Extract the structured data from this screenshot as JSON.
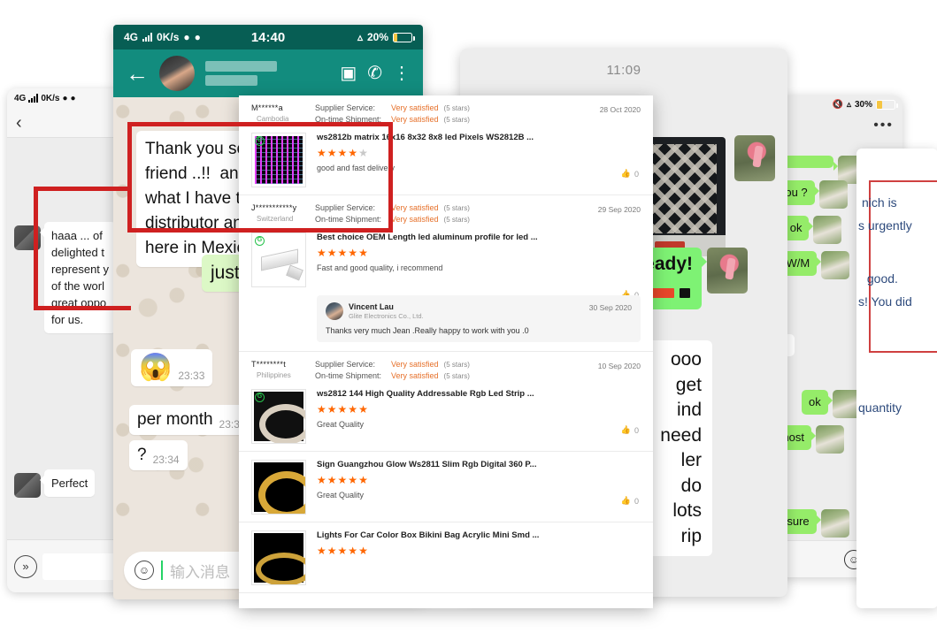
{
  "left_phone": {
    "status": {
      "network": "4G",
      "speed": "0K/s"
    },
    "back_icon": "‹",
    "messages": [
      {
        "text": "haaa ... of\ndelighted t\nrepresent y\nof the worl\ngreat oppo\nfor us."
      },
      {
        "text": "Perfect"
      }
    ],
    "voice_icon": "»"
  },
  "whatsapp": {
    "status": {
      "network": "4G",
      "speed": "0K/s",
      "time": "14:40",
      "battery": "20%"
    },
    "nav": {
      "back_icon": "←",
      "video_icon": "▶",
      "call_icon": "✆",
      "menu_icon": "⋮"
    },
    "messages": [
      {
        "type": "in",
        "text": "Thank you so m\nfriend ..!!  an ac\nwhat I have to c\ndistributor and\nhere in Mexico"
      },
      {
        "type": "out",
        "text": "just se"
      },
      {
        "type": "emoji",
        "text": "😱",
        "time": "23:33"
      },
      {
        "type": "in",
        "text": "per month",
        "time": "23:3"
      },
      {
        "type": "in",
        "text": "?",
        "time": "23:34"
      }
    ],
    "input": {
      "placeholder": "输入消息",
      "emoji_icon": "☺"
    }
  },
  "wechat_mid": {
    "timestamp": "11:09",
    "messages": [
      {
        "type": "out",
        "text": "ready!"
      },
      {
        "type": "in",
        "text": "ooo\nget\nind\nneed\nler\ndo\nlots\nrip"
      }
    ]
  },
  "wechat_right": {
    "status": {
      "battery": "30%"
    },
    "menu_icon": "•••",
    "messages": [
      {
        "text": "e you ?"
      },
      {
        "text": "v all ok"
      },
      {
        "text": "18W/M"
      },
      {
        "text": "ok"
      },
      {
        "text": "ok"
      },
      {
        "text": "utmost"
      },
      {
        "text": "leasure"
      }
    ],
    "footer": {
      "emoji_icon": "☺",
      "plus_icon": "+"
    }
  },
  "right_card": {
    "lines": [
      "nich is",
      "s urgently",
      " good.",
      "s! You did",
      "quantity"
    ]
  },
  "reviews": {
    "labels": {
      "supplier_service": "Supplier Service:",
      "on_time_shipment": "On-time Shipment:",
      "stars_note": "(5 stars)"
    },
    "items": [
      {
        "buyer": "M******a",
        "country": "Cambodia",
        "date": "28 Oct 2020",
        "supplier_service": "Very satisfied",
        "on_time_shipment": "Very satisfied",
        "product": "ws2812b matrix 16x16 8x32 8x8 led Pixels WS2812B ...",
        "stars": 4,
        "comment": "good and fast delivery",
        "likes": "0",
        "thumb": "matrix-led-thumbnail",
        "reply": null
      },
      {
        "buyer": "J***********y",
        "country": "Switzerland",
        "date": "29 Sep 2020",
        "supplier_service": "Very satisfied",
        "on_time_shipment": "Very satisfied",
        "product": "Best choice OEM Length led aluminum profile for led ...",
        "stars": 5,
        "comment": "Fast and good quality, i recommend",
        "likes": "0",
        "thumb": "aluminum-profile-thumbnail",
        "reply": {
          "name": "Vincent Lau",
          "company": "Glite Electronics Co., Ltd.",
          "date": "30 Sep 2020",
          "text": "Thanks very much   Jean  .Really happy to work with you .0"
        }
      },
      {
        "buyer": "T********t",
        "country": "Philippines",
        "date": "10 Sep 2020",
        "supplier_service": "Very satisfied",
        "on_time_shipment": "Very satisfied",
        "product": "ws2812 144 High Quality Addressable Rgb Led Strip ...",
        "stars": 5,
        "comment": "Great Quality",
        "likes": "0",
        "thumb": "led-strip-roll-thumbnail",
        "reply": null
      },
      {
        "buyer": "",
        "country": "",
        "date": "",
        "supplier_service": "",
        "on_time_shipment": "",
        "product": "Sign Guangzhou Glow Ws2811 Slim Rgb Digital 360 P...",
        "stars": 5,
        "comment": "Great Quality",
        "likes": "0",
        "thumb": "gold-neon-ring-thumbnail",
        "reply": null
      },
      {
        "buyer": "",
        "country": "",
        "date": "",
        "supplier_service": "",
        "on_time_shipment": "",
        "product": "Lights For Car Color Box Bikini Bag Acrylic Mini Smd ...",
        "stars": 5,
        "comment": "",
        "likes": "",
        "thumb": "mini-smd-thumbnail",
        "reply": null
      }
    ]
  },
  "colors": {
    "orange": "#f60",
    "wa_teal": "#128c7e",
    "wa_dark_teal": "#075e54",
    "wechat_green": "#95ec69",
    "red_box": "#cf2020"
  }
}
